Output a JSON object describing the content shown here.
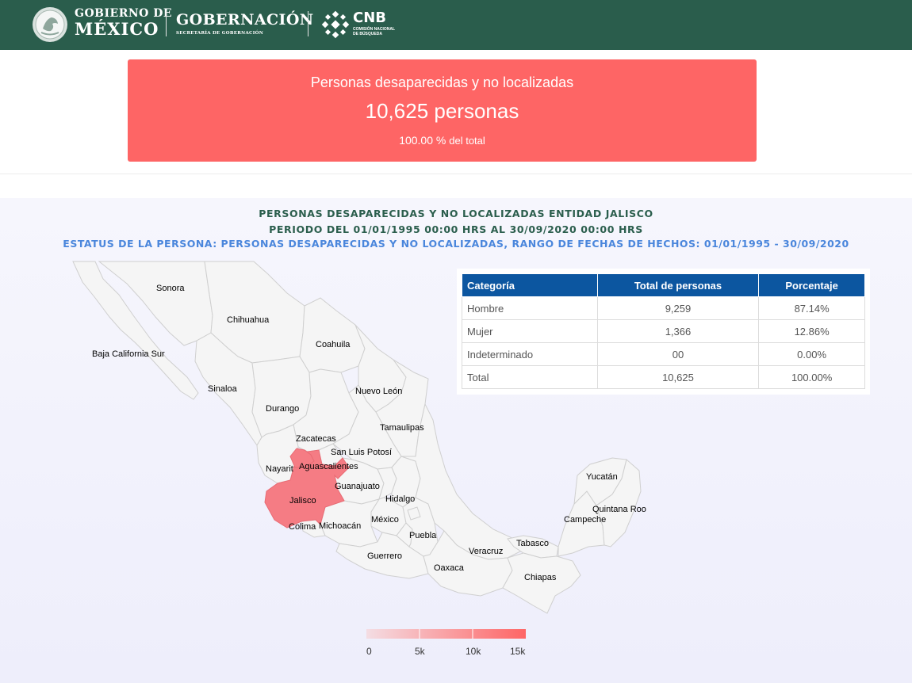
{
  "header": {
    "gobierno_line1": "GOBIERNO DE",
    "gobierno_line2": "MÉXICO",
    "gobernacion": "GOBERNACIÓN",
    "gobernacion_sub": "SECRETARÍA DE GOBERNACIÓN",
    "cnb": "CNB",
    "cnb_sub": "COMISIÓN NACIONAL DE BÚSQUEDA",
    "colors": {
      "bar": "#2a5d4c"
    }
  },
  "summary": {
    "title": "Personas desaparecidas y no localizadas",
    "count": "10,625 personas",
    "percent": "100.00 %",
    "percent_suffix": "del total",
    "color": "#fe6565"
  },
  "chart": {
    "title_line1": "PERSONAS DESAPARECIDAS Y NO LOCALIZADAS ENTIDAD JALISCO",
    "title_line2": "PERIODO DEL 01/01/1995 00:00 HRS AL 30/09/2020 00:00 HRS",
    "subtitle": "ESTATUS DE LA PERSONA: PERSONAS DESAPARECIDAS Y NO LOCALIZADAS, RANGO DE FECHAS DE HECHOS: 01/01/1995 - 30/09/2020"
  },
  "map": {
    "highlighted_state": "Jalisco",
    "highlight_color": "#f57c84",
    "state_labels": [
      "Sonora",
      "Chihuahua",
      "Baja California Sur",
      "Coahuila",
      "Sinaloa",
      "Nuevo León",
      "Durango",
      "Tamaulipas",
      "Zacatecas",
      "San Luis Potosí",
      "Nayarit",
      "Aguascalientes",
      "Guanajuato",
      "Jalisco",
      "Hidalgo",
      "México",
      "Colima",
      "Michoacán",
      "Puebla",
      "Veracruz",
      "Tabasco",
      "Guerrero",
      "Oaxaca",
      "Chiapas",
      "Yucatán",
      "Quintana Roo",
      "Campeche"
    ]
  },
  "table": {
    "headers": [
      "Categoría",
      "Total de personas",
      "Porcentaje"
    ],
    "rows": [
      [
        "Hombre",
        "9,259",
        "87.14%"
      ],
      [
        "Mujer",
        "1,366",
        "12.86%"
      ],
      [
        "Indeterminado",
        "00",
        "0.00%"
      ],
      [
        "Total",
        "10,625",
        "100.00%"
      ]
    ]
  },
  "legend": {
    "ticks": [
      "0",
      "5k",
      "10k",
      "15k"
    ],
    "color_low": "#f4dde3",
    "color_high": "#fe6565"
  }
}
